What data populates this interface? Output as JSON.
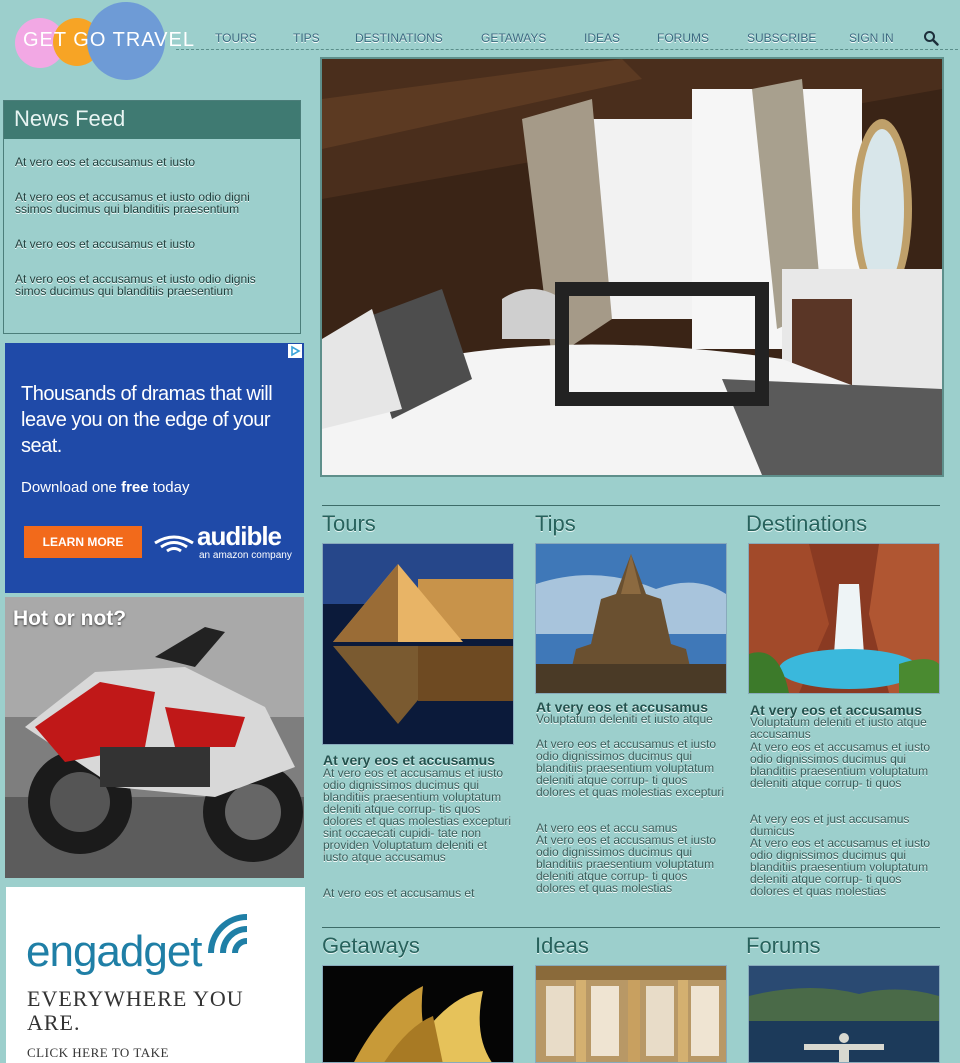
{
  "header": {
    "logo_text": "GET GO TRAVEL",
    "nav": [
      {
        "label": "TOURS"
      },
      {
        "label": "TIPS"
      },
      {
        "label": "DESTINATIONS"
      },
      {
        "label": "GETAWAYS"
      },
      {
        "label": "IDEAS"
      },
      {
        "label": "FORUMS"
      },
      {
        "label": "SUBSCRIBE"
      },
      {
        "label": "SIGN IN"
      }
    ],
    "search_icon": "search-icon"
  },
  "newsfeed": {
    "title": "News Feed",
    "items": [
      "At vero eos et accusamus et iusto",
      "At vero eos et accusamus et iusto odio digni ssimos ducimus qui blanditiis praesentium",
      "At vero eos et accusamus et iusto",
      "At vero eos et accusamus et iusto odio dignis simos ducimus qui blanditiis praesentium"
    ]
  },
  "ads": {
    "audible": {
      "headline": "Thousands of dramas that will leave you on the edge of your seat.",
      "sub_pre": "Download one ",
      "sub_bold": "free",
      "sub_post": " today",
      "button": "LEARN MORE",
      "brand": "audible",
      "brand_tag": "an amazon company"
    },
    "hot": {
      "title": "Hot or not?"
    },
    "engadget": {
      "logo": "engadget",
      "line1": "EVERYWHERE YOU ARE.",
      "line2": "CLICK HERE TO TAKE"
    }
  },
  "sections": {
    "tours": {
      "title": "Tours",
      "heading": "At very eos et accusamus",
      "text": "At vero eos et accusamus et iusto odio dignissimos ducimus qui blanditiis praesentium voluptatum deleniti atque corrup- tis quos dolores et quas molestias excepturi sint occaecati cupidi- tate non providen Voluptatum deleniti et iusto atque accusamus",
      "text2": "At vero eos et accusamus et"
    },
    "tips": {
      "title": "Tips",
      "heading": "At very eos et accusamus",
      "text": "Voluptatum deleniti et iusto atque",
      "text2": "At vero eos et accusamus et iusto odio dignissimos ducimus qui blanditiis praesentium voluptatum deleniti atque corrup- ti quos dolores et quas molestias excepturi",
      "text3": "At vero eos et accu samus",
      "text4": "At vero eos et accusamus et iusto odio dignissimos ducimus qui blanditiis praesentium voluptatum deleniti atque corrup- ti quos dolores et quas molestias"
    },
    "destinations": {
      "title": "Destinations",
      "heading": "At very eos et accusamus",
      "text": "Voluptatum deleniti et iusto atque accusamus",
      "text2": "At vero eos et accusamus et iusto odio dignissimos ducimus qui blanditiis praesentium voluptatum deleniti atque corrup- ti quos",
      "text3": "At very eos et just accusamus dumicus",
      "text4": "At vero eos et accusamus et iusto odio dignissimos ducimus qui blanditiis praesentium voluptatum deleniti atque corrup- ti quos dolores et quas molestias"
    },
    "getaways": {
      "title": "Getaways"
    },
    "ideas": {
      "title": "Ideas"
    },
    "forums": {
      "title": "Forums"
    }
  }
}
